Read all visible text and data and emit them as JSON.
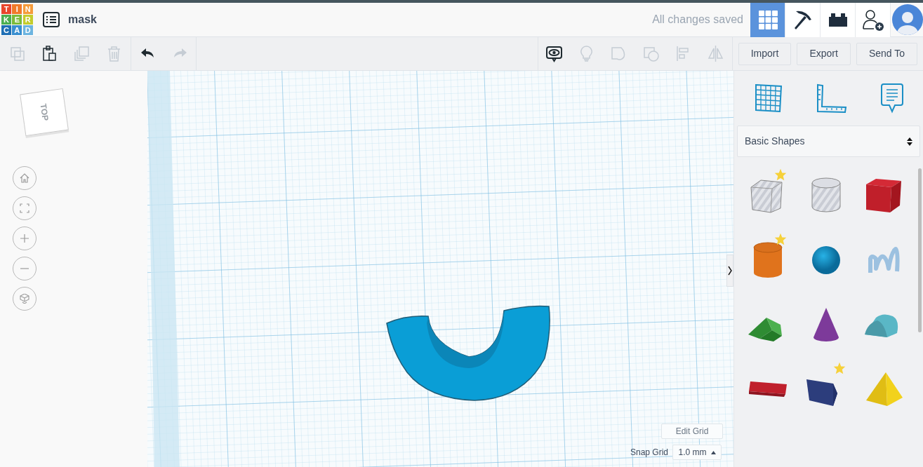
{
  "logo": {
    "letters": [
      {
        "char": "T",
        "color": "#e8452c"
      },
      {
        "char": "I",
        "color": "#f07a2a"
      },
      {
        "char": "N",
        "color": "#f59b3a"
      },
      {
        "char": "K",
        "color": "#4caf50"
      },
      {
        "char": "E",
        "color": "#7cbb3a"
      },
      {
        "char": "R",
        "color": "#c4cc2c"
      },
      {
        "char": "C",
        "color": "#1f6fb5"
      },
      {
        "char": "A",
        "color": "#3a8fd0"
      },
      {
        "char": "D",
        "color": "#6cb4e0"
      }
    ]
  },
  "design_title": "mask",
  "save_status": "All changes saved",
  "nav_tabs": [
    {
      "kind": "design",
      "selected": true
    },
    {
      "kind": "codeblocks",
      "selected": false
    },
    {
      "kind": "bricks",
      "selected": false
    }
  ],
  "edit_tools": [
    {
      "kind": "copy",
      "disabled": true
    },
    {
      "kind": "paste",
      "disabled": false
    },
    {
      "kind": "duplicate",
      "disabled": true
    },
    {
      "kind": "delete",
      "disabled": true
    }
  ],
  "history_tools": [
    {
      "kind": "undo",
      "disabled": false
    },
    {
      "kind": "redo",
      "disabled": true
    }
  ],
  "view_tools": [
    {
      "kind": "notes",
      "disabled": false
    },
    {
      "kind": "light",
      "disabled": true
    },
    {
      "kind": "solid",
      "disabled": true
    },
    {
      "kind": "hole",
      "disabled": true
    },
    {
      "kind": "align",
      "disabled": true
    },
    {
      "kind": "mirror",
      "disabled": true
    }
  ],
  "actions": [
    "Import",
    "Export",
    "Send To"
  ],
  "view_cube": {
    "face": "TOP"
  },
  "view_controls": [
    {
      "kind": "home"
    },
    {
      "kind": "fit"
    },
    {
      "kind": "zoom-in"
    },
    {
      "kind": "zoom-out"
    },
    {
      "kind": "perspective"
    }
  ],
  "canvas": {
    "edit_grid": "Edit Grid",
    "snap_label": "Snap Grid",
    "snap_value": "1.0 mm"
  },
  "shapes_panel": {
    "category": "Basic Shapes",
    "shapes": [
      {
        "kind": "box-hole",
        "starred": true
      },
      {
        "kind": "cylinder-hole",
        "starred": false
      },
      {
        "kind": "box",
        "starred": false
      },
      {
        "kind": "cylinder",
        "starred": true
      },
      {
        "kind": "sphere",
        "starred": false
      },
      {
        "kind": "scribble",
        "starred": false
      },
      {
        "kind": "roof",
        "starred": false
      },
      {
        "kind": "cone",
        "starred": false
      },
      {
        "kind": "round-roof",
        "starred": false
      },
      {
        "kind": "text",
        "starred": false
      },
      {
        "kind": "prism",
        "starred": true
      },
      {
        "kind": "pyramid",
        "starred": false
      }
    ]
  }
}
